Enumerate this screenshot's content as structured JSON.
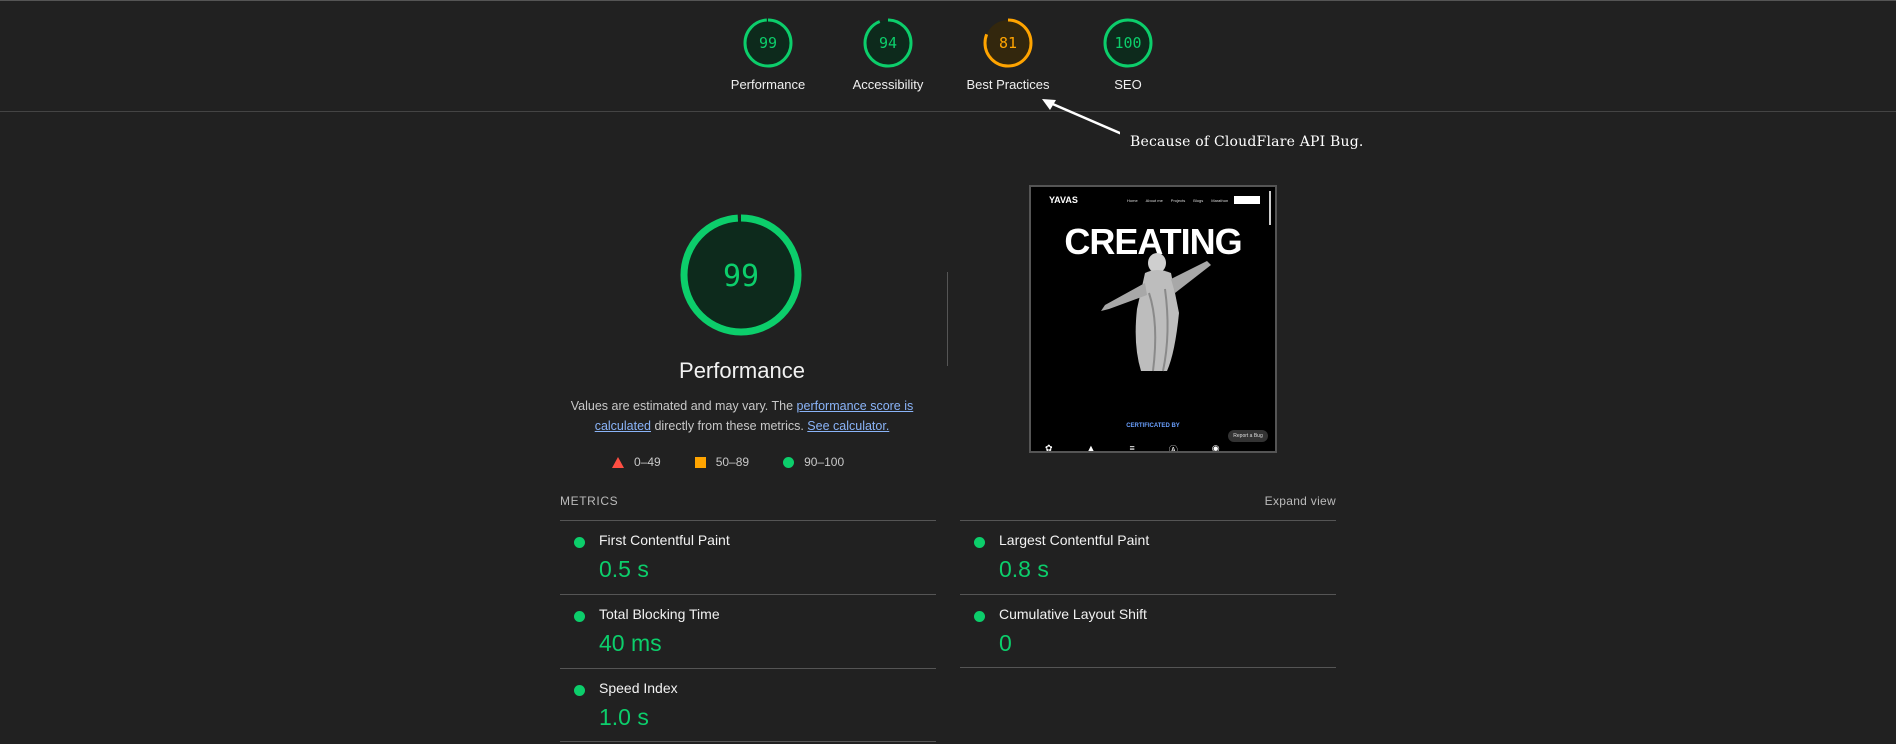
{
  "categories": [
    {
      "label": "Performance",
      "score": 99,
      "color": "#0cce6b"
    },
    {
      "label": "Accessibility",
      "score": 94,
      "color": "#0cce6b"
    },
    {
      "label": "Best Practices",
      "score": 81,
      "color": "#ffa400"
    },
    {
      "label": "SEO",
      "score": 100,
      "color": "#0cce6b"
    }
  ],
  "annotation": "Because of CloudFlare API Bug.",
  "main": {
    "score": "99",
    "score_value": 99,
    "title": "Performance",
    "desc_1": "Values are estimated and may vary. The ",
    "desc_link_1": "performance score is calculated",
    "desc_2": " directly from these metrics. ",
    "desc_link_2": "See calculator."
  },
  "legend": {
    "fail": "0–49",
    "average": "50–89",
    "pass": "90–100"
  },
  "screenshot": {
    "logo": "YAVAS",
    "nav": [
      "Home",
      "About me",
      "Projects",
      "Blogs",
      "Marathon"
    ],
    "headline": "CREATING",
    "cert": "CERTIFICATED BY",
    "bug": "Report a Bug"
  },
  "metrics": {
    "header": "METRICS",
    "expand": "Expand view",
    "items": [
      {
        "name": "First Contentful Paint",
        "value": "0.5 s"
      },
      {
        "name": "Largest Contentful Paint",
        "value": "0.8 s"
      },
      {
        "name": "Total Blocking Time",
        "value": "40 ms"
      },
      {
        "name": "Cumulative Layout Shift",
        "value": "0"
      },
      {
        "name": "Speed Index",
        "value": "1.0 s"
      }
    ]
  },
  "colors": {
    "pass": "#0cce6b",
    "average": "#ffa400",
    "fail": "#ff4e42",
    "link": "#8ab4f8"
  }
}
